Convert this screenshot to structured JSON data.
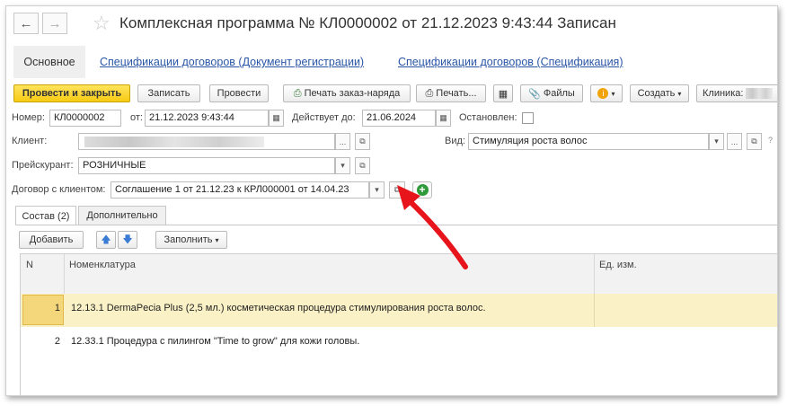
{
  "window": {
    "title": "Комплексная программа № КЛ0000002 от 21.12.2023 9:43:44 Записан"
  },
  "nav_tabs": {
    "active": "Основное",
    "links": [
      "Спецификации договоров (Документ регистрации)",
      "Спецификации договоров (Спецификация)"
    ]
  },
  "toolbar": {
    "post_close": "Провести и закрыть",
    "save": "Записать",
    "post": "Провести",
    "print_order": "Печать заказ-наряда",
    "print": "Печать...",
    "files": "Файлы",
    "create": "Создать",
    "clinic_label": "Клиника:"
  },
  "form": {
    "number_label": "Номер:",
    "number_value": "КЛ0000002",
    "date_label": "от:",
    "date_value": "21.12.2023  9:43:44",
    "valid_label": "Действует до:",
    "valid_value": "21.06.2024",
    "stopped_label": "Остановлен:",
    "client_label": "Клиент:",
    "kind_label": "Вид:",
    "kind_value": "Стимуляция роста волос",
    "price_label": "Прейскурант:",
    "price_value": "РОЗНИЧНЫЕ",
    "contract_label": "Договор с клиентом:",
    "contract_value": "Соглашение 1 от 21.12.23 к КРЛ000001 от 14.04.23",
    "dots": "...",
    "help": "?"
  },
  "tabs": [
    "Состав (2)",
    "Дополнительно"
  ],
  "subtoolbar": {
    "add": "Добавить",
    "fill": "Заполнить"
  },
  "grid": {
    "headers": [
      "N",
      "Номенклатура",
      "Ед. изм."
    ],
    "rows": [
      {
        "n": "1",
        "name": "12.13.1 DermaPecia Plus (2,5 мл.) косметическая процедура стимулирования роста волос."
      },
      {
        "n": "2",
        "name": "12.33.1 Процедура с пилингом \"Time to grow\" для кожи головы."
      }
    ]
  },
  "colors": {
    "primary_button": "#f7cb14",
    "link": "#2a56a6",
    "selected_row": "#fbf1c6",
    "arrow": "#e8141b"
  }
}
